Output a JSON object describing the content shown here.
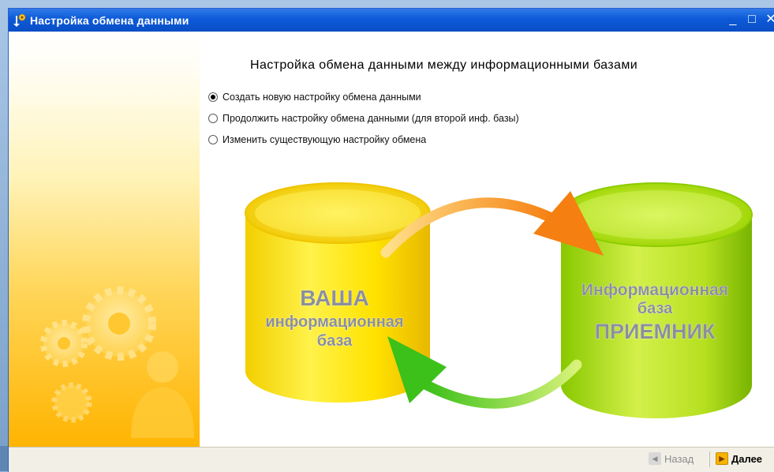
{
  "window": {
    "title": "Настройка обмена данными",
    "controls": {
      "minimize": "_",
      "maximize": "□",
      "close": "✕"
    }
  },
  "main": {
    "heading": "Настройка обмена данными между информационными базами",
    "options": [
      {
        "label": "Создать новую настройку обмена данными",
        "checked": true
      },
      {
        "label": "Продолжить настройку обмена данными (для второй инф. базы)",
        "checked": false
      },
      {
        "label": "Изменить существующую настройку обмена",
        "checked": false
      }
    ]
  },
  "diagram": {
    "left_db": {
      "line1": "ВАША",
      "line2": "информационная",
      "line3": "база",
      "color": "#ffe000"
    },
    "right_db": {
      "line1": "Информационная",
      "line2": "база",
      "line3": "ПРИЕМНИК",
      "color": "#b8e000"
    },
    "arrow_top_color": "#f57f10",
    "arrow_bottom_color": "#3cc01a"
  },
  "footer": {
    "back_label": "Назад",
    "next_label": "Далее"
  },
  "icons": {
    "app": "data-exchange-icon",
    "back": "arrow-left-icon",
    "next": "arrow-right-icon",
    "sidebar": "gears-person-icon"
  }
}
